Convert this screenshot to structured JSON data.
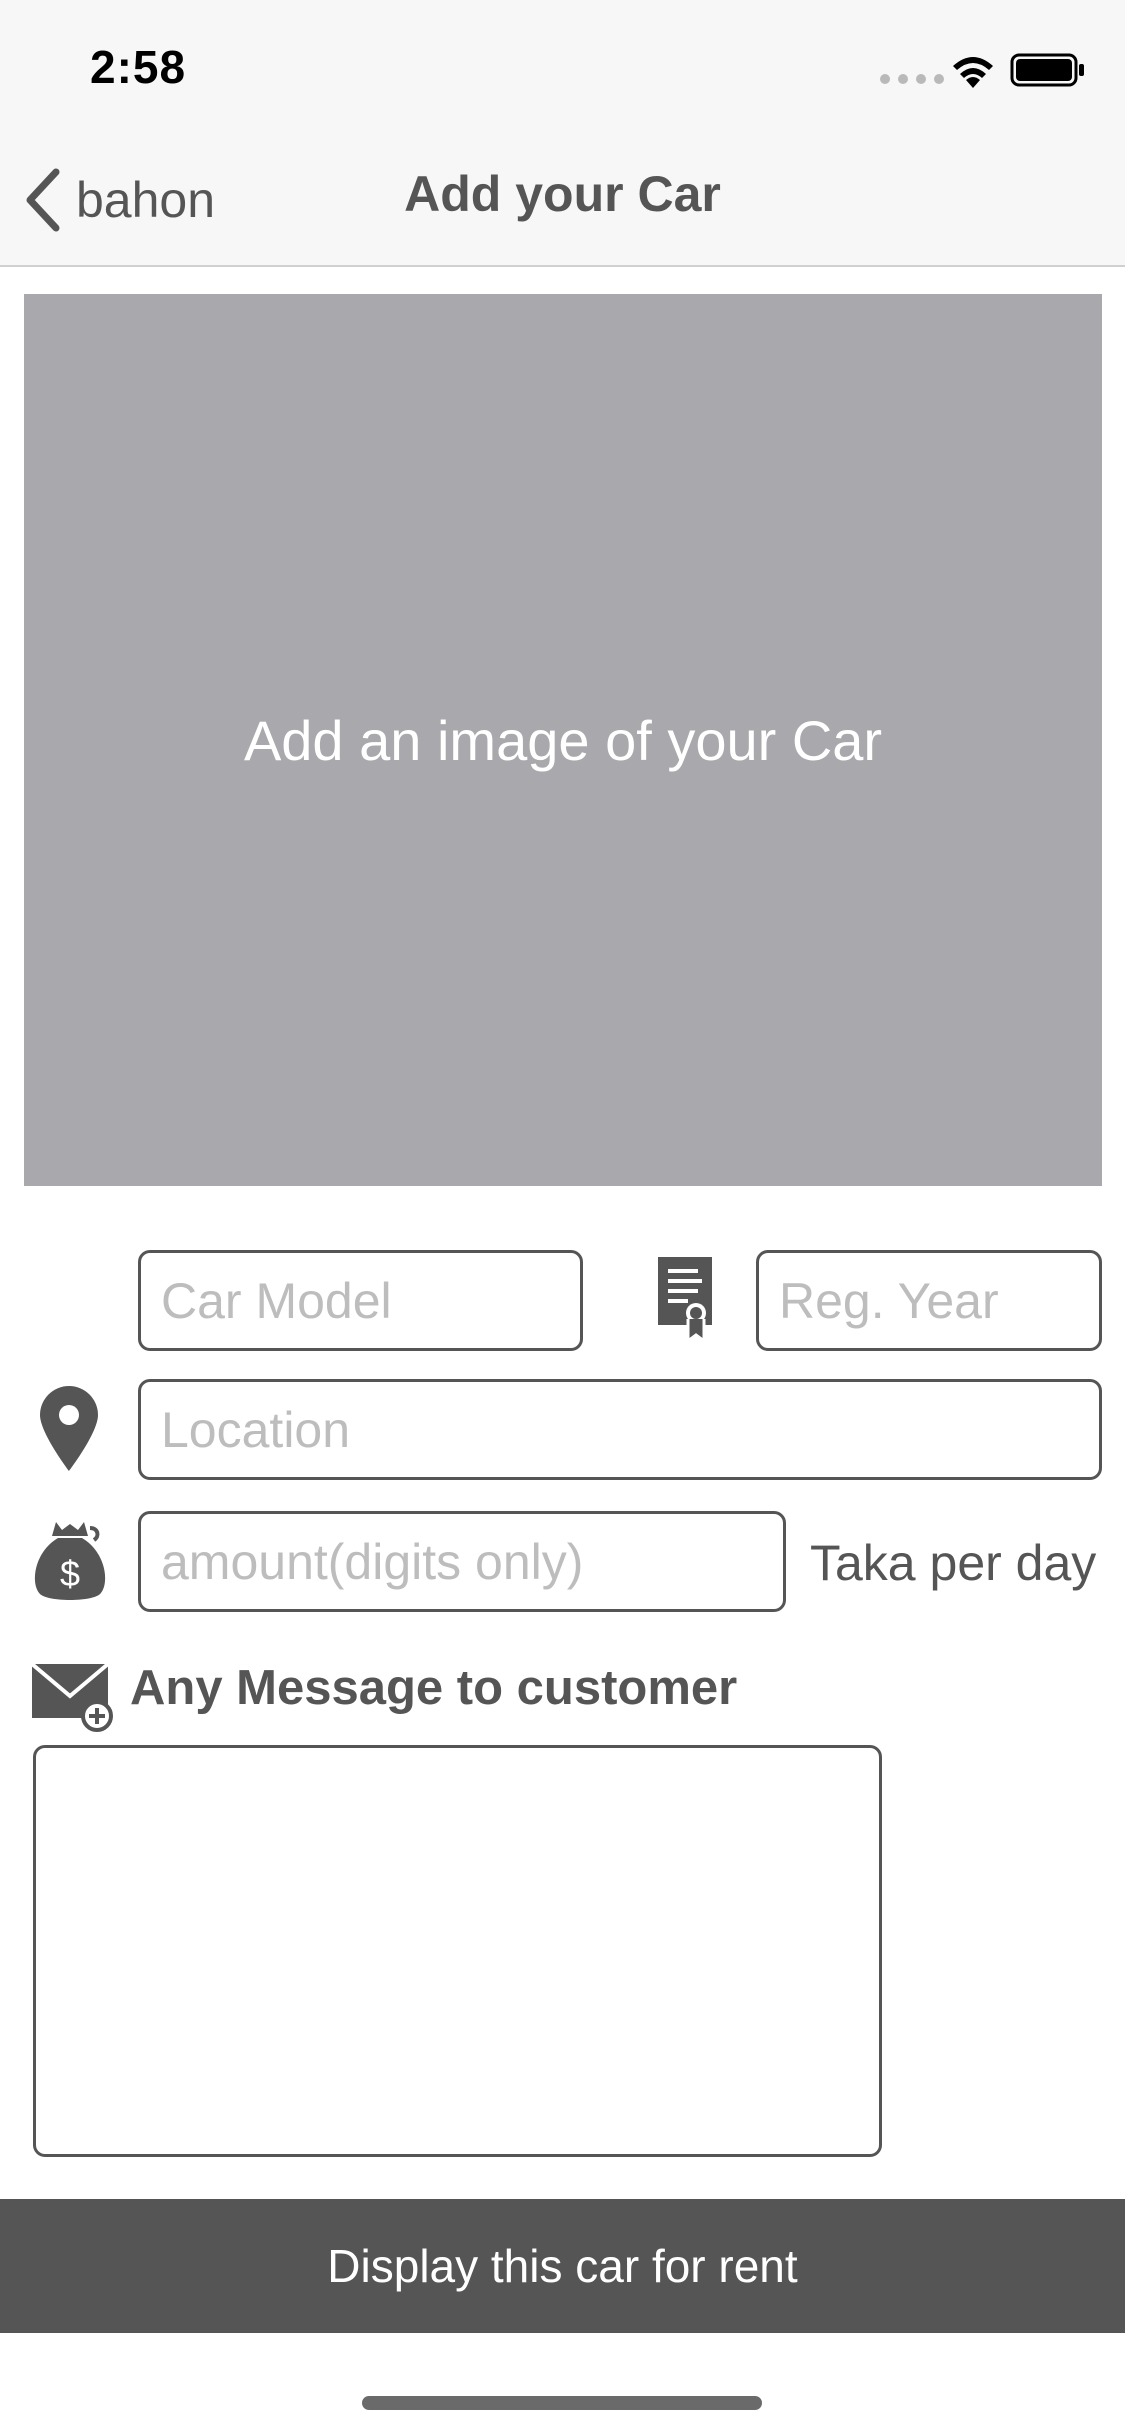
{
  "status_bar": {
    "time": "2:58",
    "icons": [
      "signal-icon",
      "wifi-icon",
      "battery-icon"
    ]
  },
  "nav": {
    "back_label": "bahon",
    "title": "Add your Car"
  },
  "image_placeholder": {
    "label": "Add an image of your Car"
  },
  "form": {
    "car_model": {
      "value": "",
      "placeholder": "Car Model"
    },
    "reg_year": {
      "value": "",
      "placeholder": "Reg. Year"
    },
    "location": {
      "value": "",
      "placeholder": "Location"
    },
    "amount": {
      "value": "",
      "placeholder": "amount(digits only)"
    },
    "per_day_label": "Taka per day",
    "message_label": "Any Message to customer",
    "message_value": ""
  },
  "submit_label": "Display this car for rent",
  "colors": {
    "accent": "#555555",
    "placeholder_bg": "#a9a9ad",
    "nav_bg": "#f7f7f7"
  }
}
